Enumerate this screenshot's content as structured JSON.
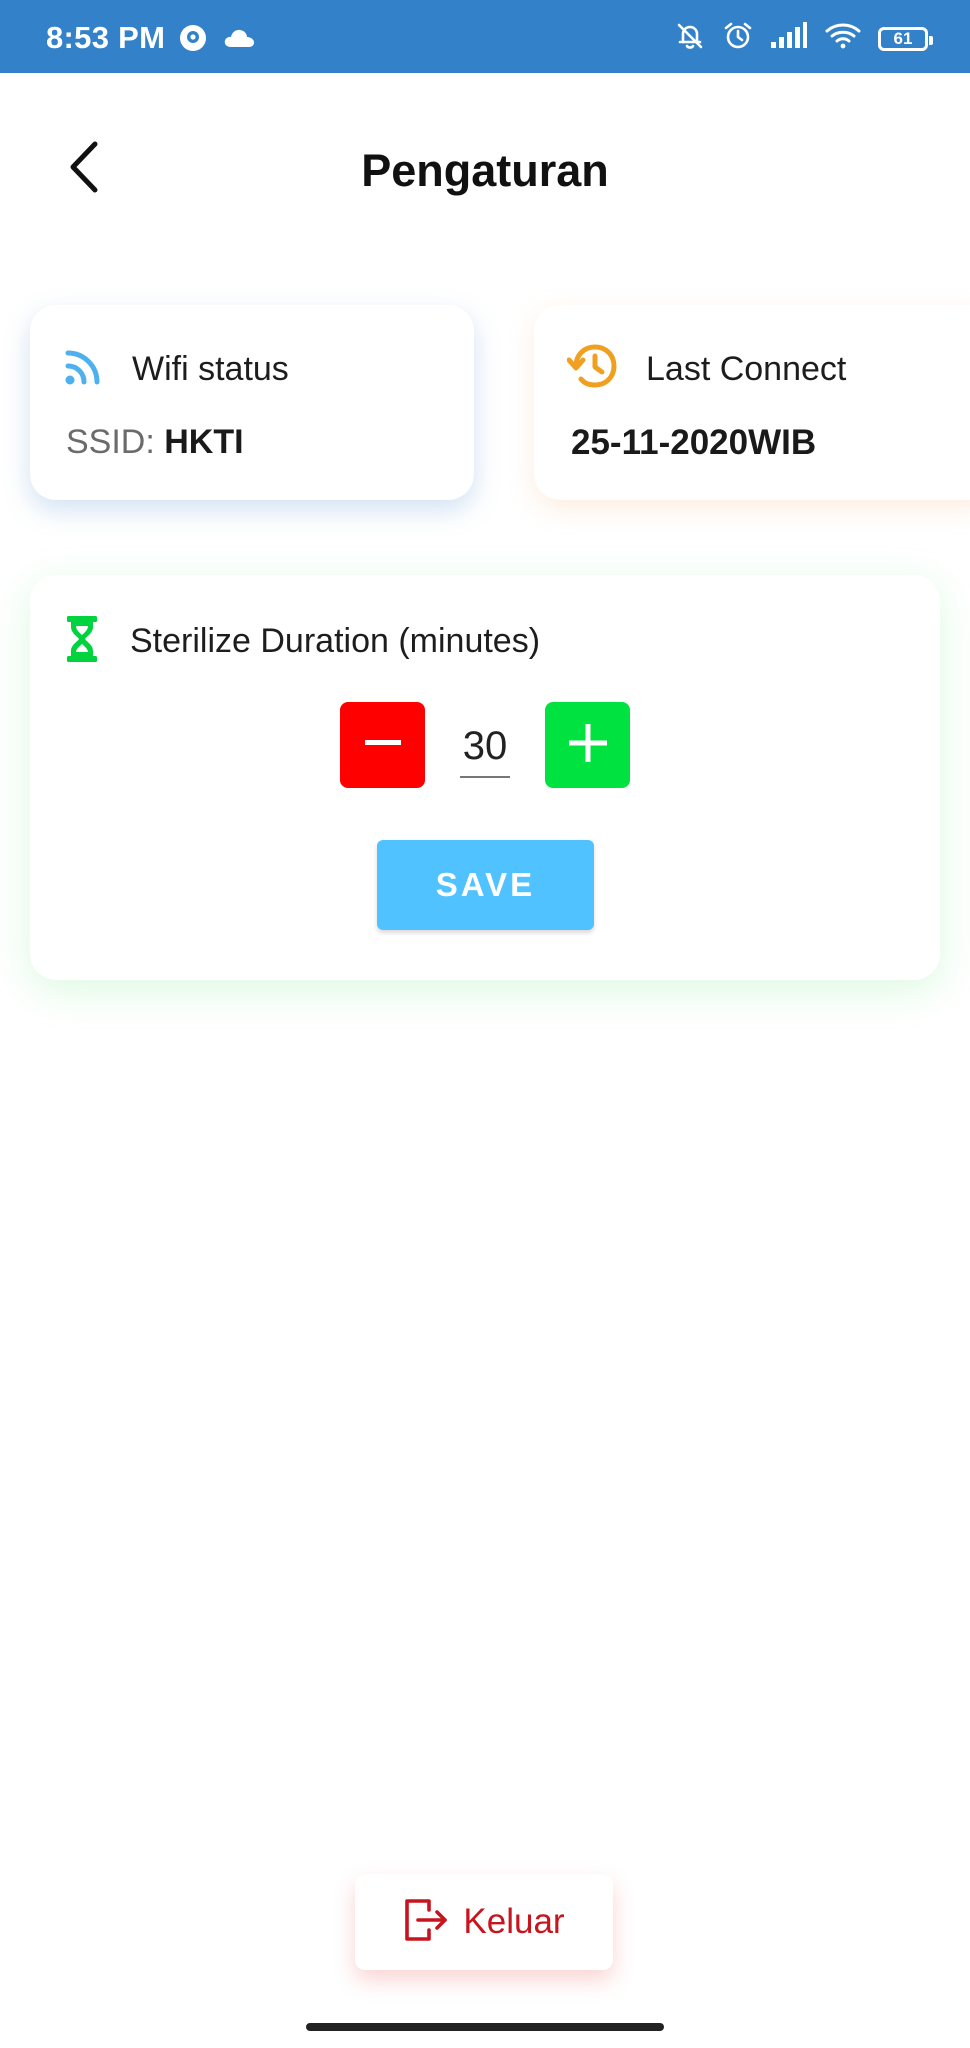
{
  "status_bar": {
    "time": "8:53 PM",
    "battery": "61",
    "left_icons": [
      "location-pin-icon",
      "cloud-icon"
    ],
    "right_icons": [
      "bell-muted-icon",
      "alarm-clock-icon",
      "signal-bars-icon",
      "wifi-icon",
      "battery-icon"
    ],
    "background": "#3381c9"
  },
  "header": {
    "title": "Pengaturan",
    "back_icon": "chevron-left-icon"
  },
  "wifi_card": {
    "title": "Wifi status",
    "ssid_label": "SSID: ",
    "ssid_value": "HKTI",
    "icon": "wifi-feed-icon",
    "icon_color": "#4eb0ec"
  },
  "last_connect_card": {
    "title": "Last Connect",
    "value": "25-11-2020WIB",
    "icon": "history-icon",
    "icon_color": "#f0a020"
  },
  "duration_card": {
    "title": "Sterilize Duration (minutes)",
    "icon": "hourglass-icon",
    "icon_color": "#00d33d",
    "value": "30",
    "decrement_color": "#ff0000",
    "increment_color": "#00e240",
    "save_label": "SAVE",
    "save_color": "#4fc2ff"
  },
  "logout": {
    "label": "Keluar",
    "icon": "logout-icon",
    "color": "#c8141e"
  }
}
